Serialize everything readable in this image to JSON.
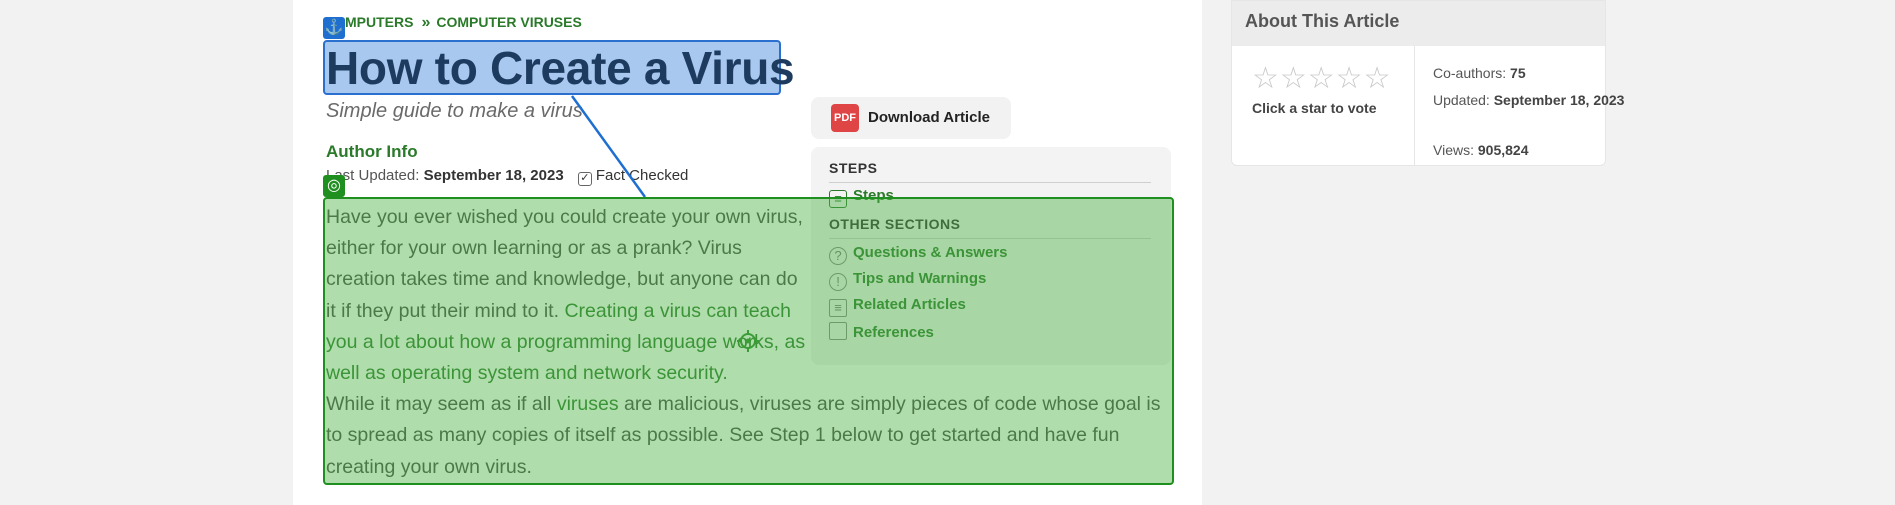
{
  "breadcrumb": {
    "parent": "MPUTERS",
    "separator": "»",
    "current": "COMPUTER VIRUSES"
  },
  "article": {
    "title": "How to Create a Virus",
    "subtitle": "Simple guide to make a virus",
    "author_label": "Author Info",
    "last_updated_label": "Last Updated:",
    "last_updated_value": "September 18, 2023",
    "fact_checked": "Fact Checked"
  },
  "intro": {
    "line1": "Have you ever wished you could create your own virus, either for your own learning or as a prank? Virus creation takes time and knowledge, but anyone can do it if they put their mind to it.",
    "link1": "Creating a virus can teach you a lot about how a programming language works, as well as operating system and network security.",
    "part2_a": " While it may seem as if all ",
    "link2": "viruses",
    "part2_b": " are malicious, viruses are simply pieces of code whose goal is to spread as many copies of itself as possible. See Step 1 below to get started and have fun creating your own virus."
  },
  "download": {
    "icon": "pdf-icon",
    "icon_text": "PDF",
    "label": "Download Article"
  },
  "toc": {
    "steps_heading": "STEPS",
    "steps_item": "Steps",
    "other_heading": "OTHER SECTIONS",
    "items": [
      {
        "label": "Questions & Answers",
        "icon": "question-icon",
        "glyph": "?"
      },
      {
        "label": "Tips and Warnings",
        "icon": "exclamation-icon",
        "glyph": "!"
      },
      {
        "label": "Related Articles",
        "icon": "document-icon",
        "glyph": "≡"
      },
      {
        "label": "References",
        "icon": "book-icon",
        "glyph": ""
      }
    ]
  },
  "about": {
    "title": "About This Article",
    "stars": "☆☆☆☆☆",
    "vote_label": "Click a star to vote",
    "coauthors_label": "Co-authors:",
    "coauthors_value": "75",
    "updated_label": "Updated:",
    "updated_value": "September 18, 2023",
    "views_label": "Views:",
    "views_value": "905,824"
  },
  "annotations": {
    "anchor_glyph": "⚓",
    "target_glyph": "◎"
  },
  "colors": {
    "link_green": "#2a7a2a",
    "anchor_blue": "#2b6fcf",
    "target_green": "#1f8f1f"
  }
}
